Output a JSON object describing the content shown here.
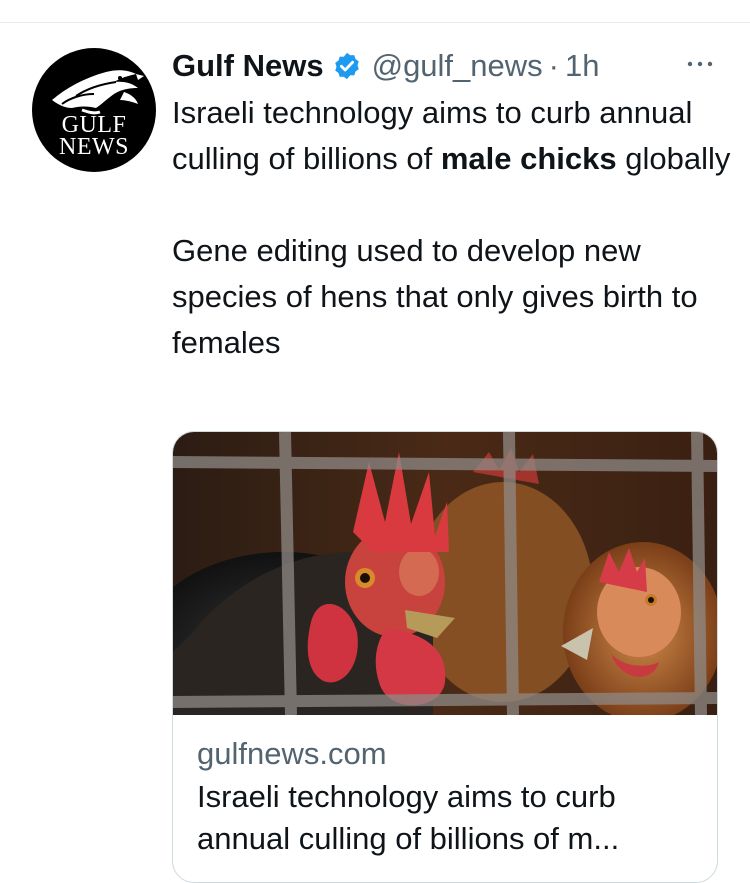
{
  "tweet": {
    "author": {
      "display_name": "Gulf News",
      "handle": "@gulf_news",
      "separator": "·",
      "time": "1h",
      "verified": true,
      "avatar_text_line1": "GULF",
      "avatar_text_line2": "NEWS",
      "avatar_icon": "falcon-logo"
    },
    "body": {
      "line1_prefix": "Israeli technology aims to curb annual culling of billions of ",
      "line1_bold": "male chicks",
      "line1_suffix": " globally",
      "line2": "Gene editing used to develop new species of hens that only gives birth to females"
    },
    "more_icon": "more-horizontal-icon",
    "card": {
      "image_subject": "chickens-behind-cage",
      "domain": "gulfnews.com",
      "title": "Israeli technology aims to curb annual culling of billions of m..."
    }
  },
  "colors": {
    "text_primary": "#0f1419",
    "text_secondary": "#536471",
    "verified_blue": "#1d9bf0",
    "border": "#cfd9de"
  }
}
